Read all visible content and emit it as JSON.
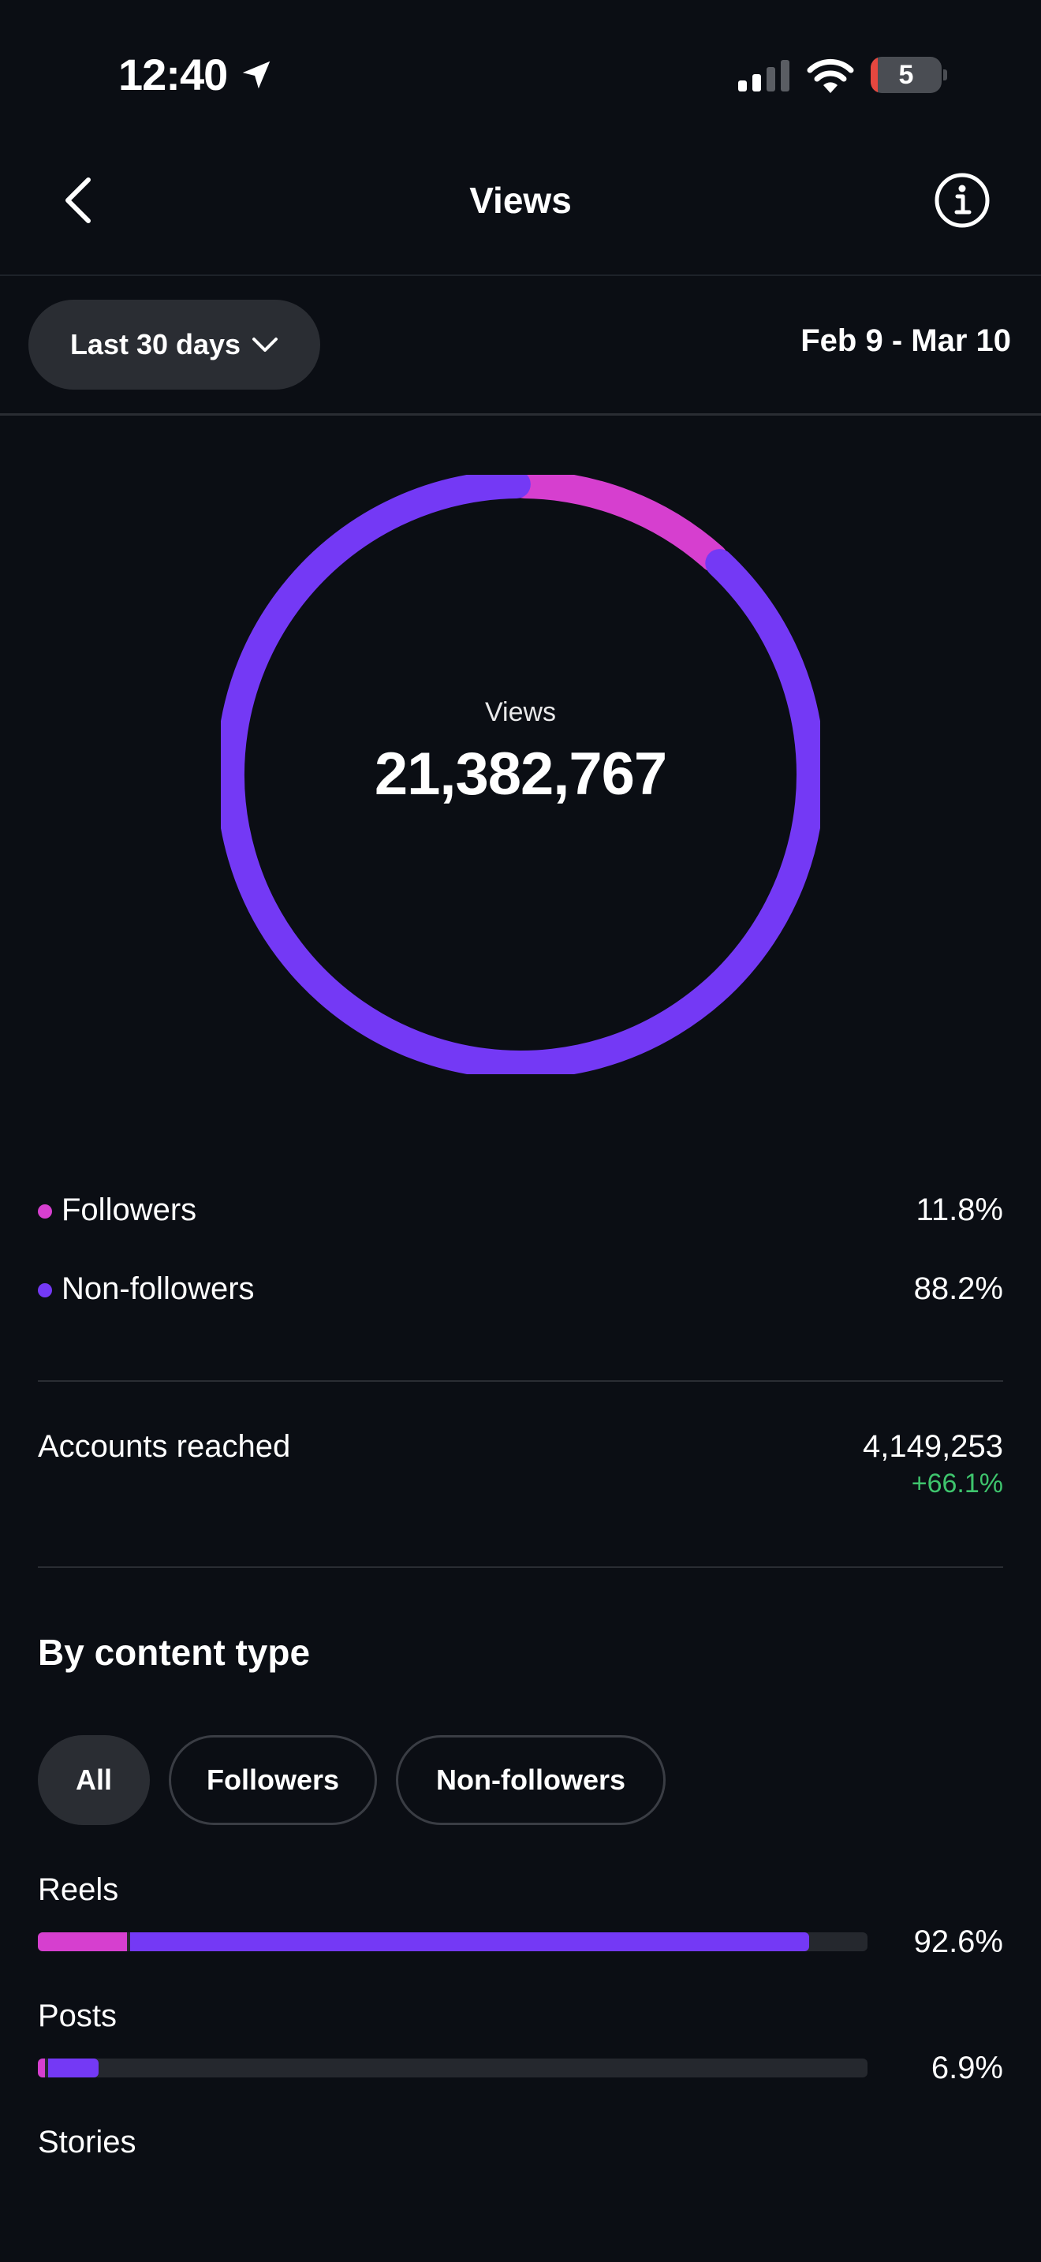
{
  "status_bar": {
    "time": "12:40",
    "battery": "5"
  },
  "header": {
    "title": "Views"
  },
  "filter": {
    "range_label": "Last 30 days",
    "date_range": "Feb 9 - Mar 10"
  },
  "summary": {
    "label": "Views",
    "total": "21,382,767"
  },
  "chart_data": {
    "type": "pie",
    "categories": [
      "Followers",
      "Non-followers"
    ],
    "values": [
      11.8,
      88.2
    ],
    "colors": [
      "#d63fcf",
      "#7439f5"
    ]
  },
  "legend": [
    {
      "label": "Followers",
      "value": "11.8%",
      "color": "#d63fcf"
    },
    {
      "label": "Non-followers",
      "value": "88.2%",
      "color": "#7439f5"
    }
  ],
  "accounts_reached": {
    "label": "Accounts reached",
    "value": "4,149,253",
    "change": "+66.1%"
  },
  "content_type": {
    "title": "By content type",
    "filters": [
      "All",
      "Followers",
      "Non-followers"
    ],
    "selected_filter": "All",
    "items": [
      {
        "label": "Reels",
        "value": "92.6%",
        "followers_fraction": 0.107,
        "non_followers_fraction": 0.819
      },
      {
        "label": "Posts",
        "value": "6.9%",
        "followers_fraction": 0.009,
        "non_followers_fraction": 0.06
      },
      {
        "label": "Stories"
      }
    ]
  }
}
